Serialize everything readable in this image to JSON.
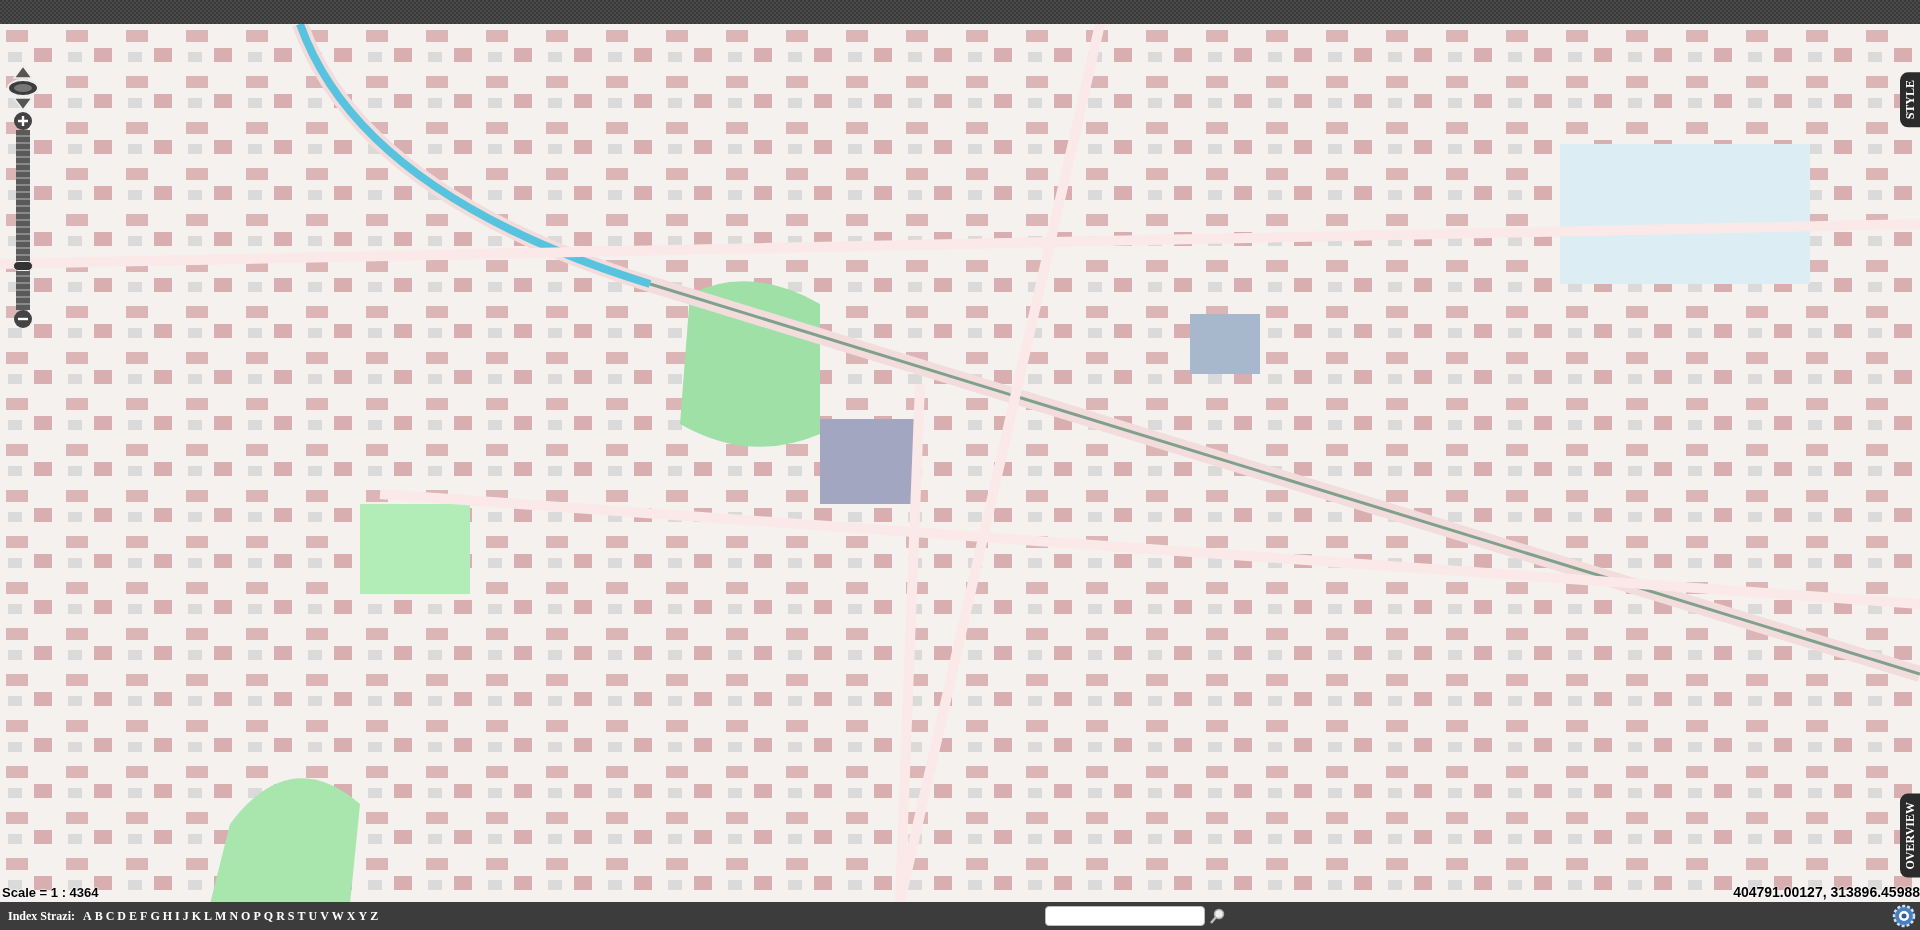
{
  "map": {
    "kind": "picture",
    "scale": "Scale = 1 : 4364",
    "coordinates": "404791.00127, 313896.45988",
    "zoom": {
      "level": 0.25
    },
    "side_tabs": [
      {
        "label": "STYLE"
      },
      {
        "label": "OVERVIEW"
      }
    ]
  },
  "footer": {
    "index_label": "Index Strazi:",
    "letters": [
      "A",
      "B",
      "C",
      "D",
      "E",
      "F",
      "G",
      "H",
      "I",
      "J",
      "K",
      "L",
      "M",
      "N",
      "O",
      "P",
      "Q",
      "R",
      "S",
      "T",
      "U",
      "V",
      "W",
      "X",
      "Y",
      "Z"
    ]
  }
}
